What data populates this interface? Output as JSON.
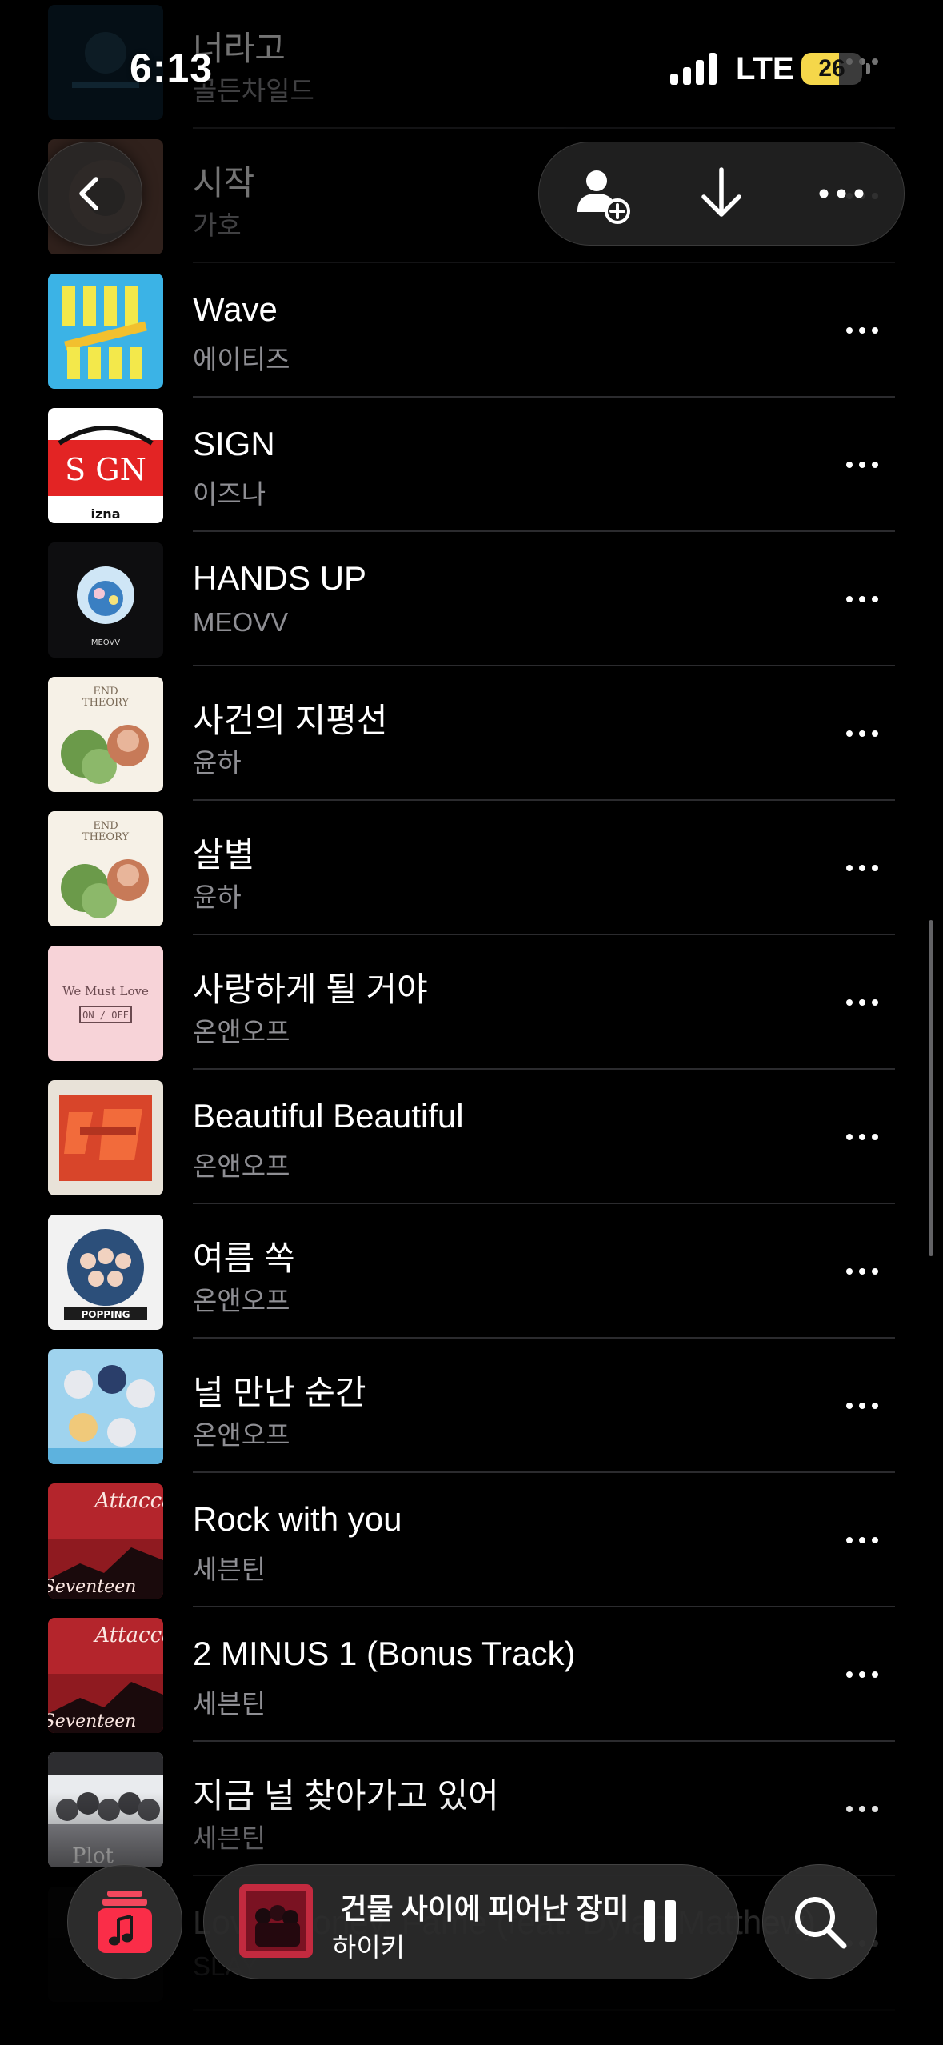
{
  "status_bar": {
    "time": "6:13",
    "network": "LTE",
    "battery": "26",
    "battery_level": 0.26
  },
  "top_bar": {
    "back_icon": "chevron-left-icon",
    "actions": [
      "add-person-icon",
      "download-icon",
      "more-icon"
    ]
  },
  "songs": [
    {
      "title": "너라고",
      "artist": "골든차일드",
      "art": "art-golden",
      "faded": true
    },
    {
      "title": "시작",
      "artist": "가호",
      "art": "art-gaho",
      "faded": true
    },
    {
      "title": "Wave",
      "artist": "에이티즈",
      "art": "art-ateez",
      "faded": false
    },
    {
      "title": "SIGN",
      "artist": "이즈나",
      "art": "art-izna",
      "faded": false
    },
    {
      "title": "HANDS UP",
      "artist": "MEOVV",
      "art": "art-meovv",
      "faded": false
    },
    {
      "title": "사건의 지평선",
      "artist": "윤하",
      "art": "art-endtheory",
      "faded": false
    },
    {
      "title": "살별",
      "artist": "윤하",
      "art": "art-endtheory",
      "faded": false
    },
    {
      "title": "사랑하게 될 거야",
      "artist": "온앤오프",
      "art": "art-wemustlove",
      "faded": false
    },
    {
      "title": "Beautiful Beautiful",
      "artist": "온앤오프",
      "art": "art-onf-red",
      "faded": false
    },
    {
      "title": "여름 쏙",
      "artist": "온앤오프",
      "art": "art-popping",
      "faded": false
    },
    {
      "title": "널 만난 순간",
      "artist": "온앤오프",
      "art": "art-onf-blue",
      "faded": false
    },
    {
      "title": "Rock with you",
      "artist": "세븐틴",
      "art": "art-attacca",
      "faded": false
    },
    {
      "title": "2 MINUS 1 (Bonus Track)",
      "artist": "세븐틴",
      "art": "art-attacca",
      "faded": false
    },
    {
      "title": "지금 널 찾아가고 있어",
      "artist": "세븐틴",
      "art": "art-sunset",
      "faded": false
    },
    {
      "title": "Love, Money, Fame (feat. Dylan Matthew)",
      "artist": "SLAY",
      "art": "art-dark",
      "faded": true
    }
  ],
  "now_playing": {
    "title": "건물 사이에 피어난 장미",
    "artist": "하이키",
    "state": "playing"
  },
  "bottom_bar": {
    "library_icon": "music-library-icon",
    "search_icon": "search-icon"
  },
  "colors": {
    "background": "#000000",
    "secondary_text": "#8e8e93",
    "divider": "#2b2b2e",
    "accent_red": "#fa2d48",
    "battery_yellow": "#f5d74a"
  }
}
